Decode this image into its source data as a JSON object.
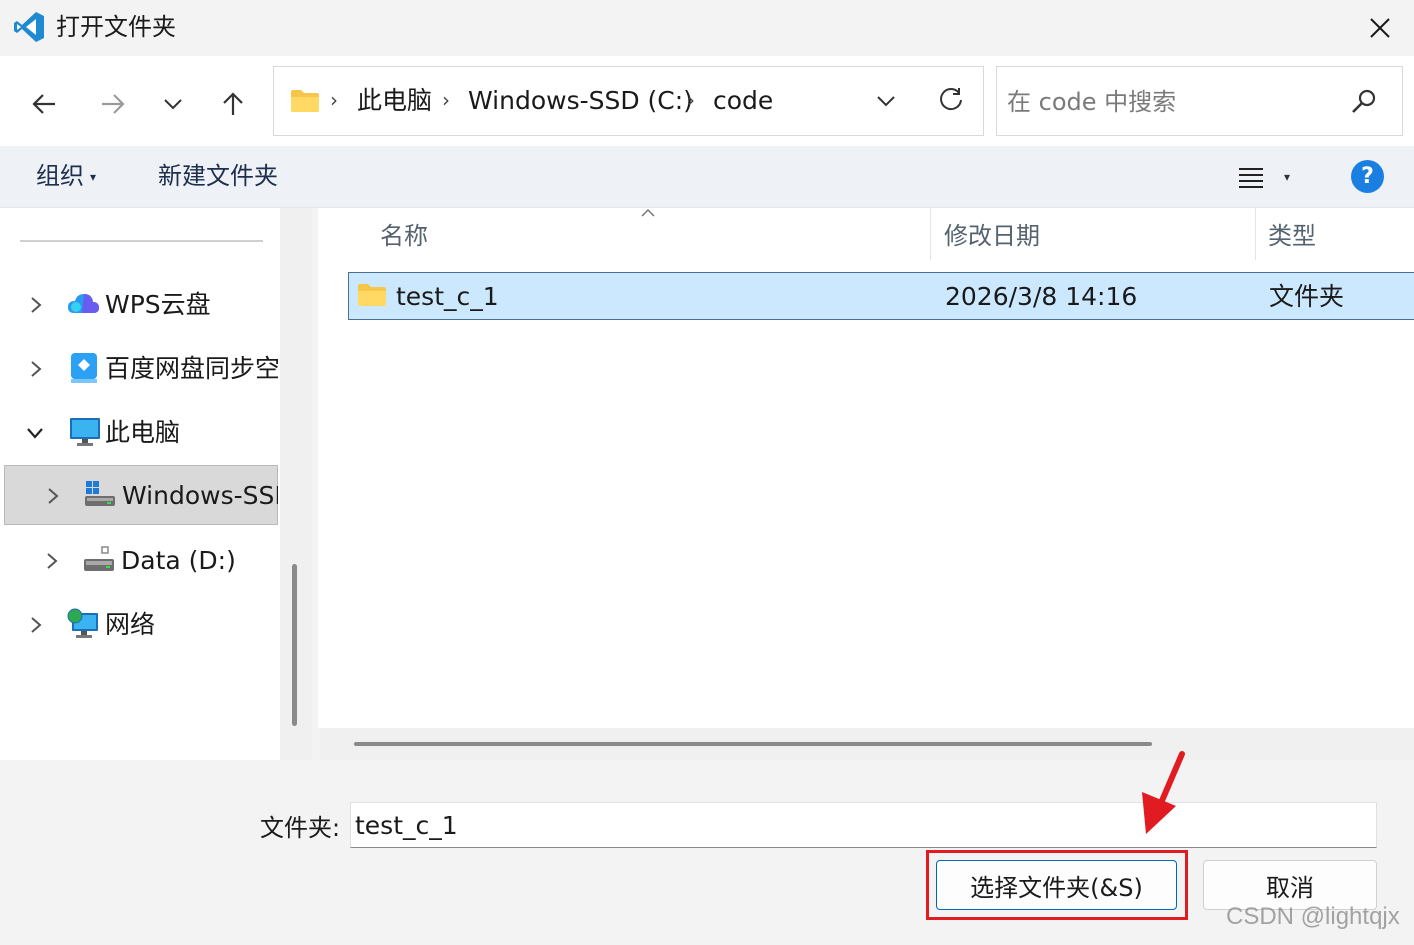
{
  "window": {
    "title": "打开文件夹"
  },
  "address": {
    "crumbs": [
      "此电脑",
      "Windows-SSD (C:)",
      "code"
    ],
    "separator": "›"
  },
  "search": {
    "placeholder": "在 code 中搜索",
    "value": ""
  },
  "commands": {
    "organize": "组织",
    "new_folder": "新建文件夹"
  },
  "sidebar": {
    "items": [
      {
        "label": "WPS云盘",
        "icon": "cloud-icon",
        "expanded": false
      },
      {
        "label": "百度网盘同步空间",
        "icon": "baidu-netdisk-icon",
        "expanded": false
      },
      {
        "label": "此电脑",
        "icon": "computer-icon",
        "expanded": true
      },
      {
        "label": "Windows-SSD (C:)",
        "icon": "windows-drive-icon",
        "expanded": false,
        "selected": true
      },
      {
        "label": "Data (D:)",
        "icon": "drive-icon",
        "expanded": false
      },
      {
        "label": "网络",
        "icon": "network-icon",
        "expanded": false
      }
    ]
  },
  "columns": {
    "name": "名称",
    "modified": "修改日期",
    "type": "类型"
  },
  "files": [
    {
      "name": "test_c_1",
      "modified": "2026/3/8 14:16",
      "type": "文件夹",
      "selected": true
    }
  ],
  "footer": {
    "folder_label": "文件夹:",
    "folder_value": "test_c_1",
    "select_button": "选择文件夹(&S)",
    "cancel_button": "取消"
  },
  "colors": {
    "accent": "#0067c0",
    "selection": "#cce8ff",
    "annotation": "#e21a22",
    "help": "#1a7fe0"
  },
  "watermark": "CSDN @lightqjx"
}
